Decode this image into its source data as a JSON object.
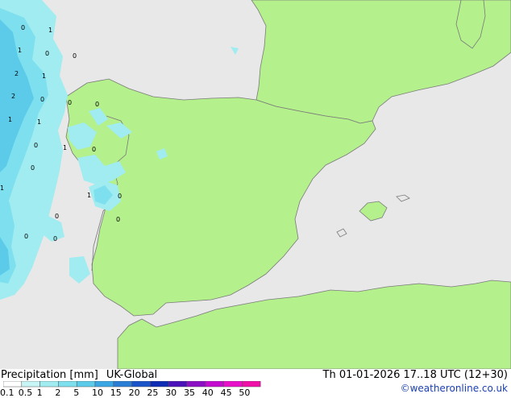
{
  "footer": {
    "title": "Precipitation [mm]",
    "model": "UK-Global",
    "datetime": "Th 01-01-2026 17..18 UTC (12+30)",
    "credit": "©weatheronline.co.uk"
  },
  "legend": {
    "ticks": [
      "0.1",
      "0.5",
      "1",
      "2",
      "5",
      "10",
      "15",
      "20",
      "25",
      "30",
      "35",
      "40",
      "45",
      "50"
    ],
    "colors": [
      "#ffffff",
      "#c8f5f5",
      "#a0ecf0",
      "#7ee0ee",
      "#5ccbea",
      "#3aa6e4",
      "#2a7ed6",
      "#1a54c8",
      "#0e2cb4",
      "#4a12b8",
      "#8c10c4",
      "#c40cd0",
      "#e810c8",
      "#f010a8"
    ]
  },
  "map_values": [
    "0",
    "1",
    "1",
    "0",
    "0",
    "2",
    "1",
    "2",
    "0",
    "0",
    "0",
    "1",
    "1",
    "0",
    "1",
    "0",
    "0",
    "1",
    "0",
    "1",
    "0",
    "0",
    "0",
    "0"
  ],
  "colors": {
    "land": "#b4f08c",
    "sea": "#e8e8e8",
    "border": "#7a7a7a",
    "precip_light": "#a0ecf0",
    "precip_mid": "#7ee0ee",
    "precip_strong": "#5ccbea"
  }
}
